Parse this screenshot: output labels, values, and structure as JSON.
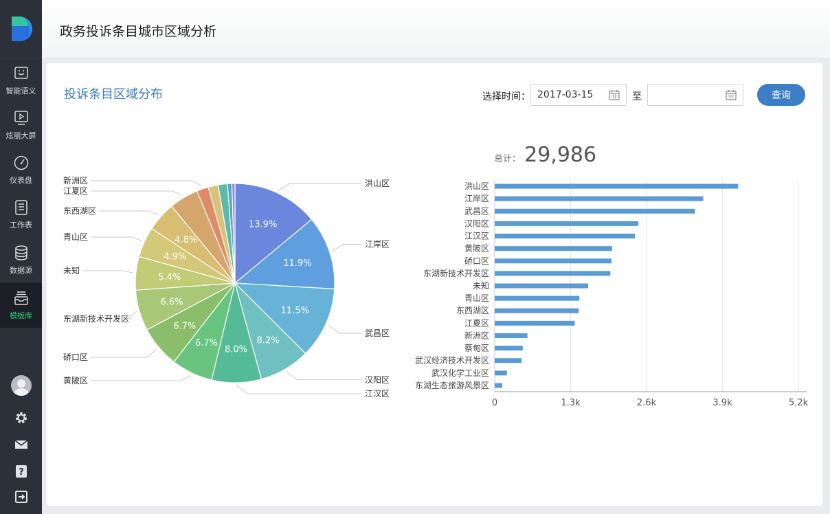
{
  "sidebar": {
    "items": [
      {
        "label": "智能语义",
        "icon": "smile-icon"
      },
      {
        "label": "炫丽大屏",
        "icon": "play-screen-icon"
      },
      {
        "label": "仪表盘",
        "icon": "gauge-icon"
      },
      {
        "label": "工作表",
        "icon": "worksheet-icon"
      },
      {
        "label": "数据源",
        "icon": "database-icon"
      },
      {
        "label": "模板库",
        "icon": "template-icon",
        "active": true
      }
    ],
    "bottom_icons": [
      "avatar",
      "gear-icon",
      "mail-icon",
      "help-icon",
      "logout-icon"
    ]
  },
  "header": {
    "title": "政务投诉条目城市区域分析"
  },
  "panel": {
    "title": "投诉条目区域分布",
    "time_label": "选择时间：",
    "start_date": "2017-03-15",
    "end_date": "",
    "to_label": "至",
    "query_button": "查询"
  },
  "total": {
    "label": "总计：",
    "value": "29,986"
  },
  "colors": {
    "accent": "#3d7fc6",
    "bar": "#5b9bd5",
    "active_nav": "#27d07e"
  },
  "chart_data": [
    {
      "type": "pie",
      "categories": [
        "洪山区",
        "江岸区",
        "武昌区",
        "汉阳区",
        "江汉区",
        "黄陂区",
        "硚口区",
        "东湖新技术开发区",
        "未知",
        "青山区",
        "东西湖区",
        "江夏区",
        "新洲区",
        "蔡甸区",
        "武汉经济技术开发区",
        "武汉化学工业区",
        "东湖生态旅游风景区"
      ],
      "values": [
        13.9,
        11.9,
        11.5,
        8.2,
        8.0,
        6.7,
        6.7,
        6.6,
        5.4,
        4.9,
        4.8,
        4.7,
        1.9,
        1.6,
        1.5,
        0.7,
        0.5
      ],
      "data_labels": [
        "13.9%",
        "11.9%",
        "11.5%",
        "8.2%",
        "8.0%",
        "6.7%",
        "6.7%",
        "6.6%",
        "5.4%",
        "4.9%",
        "4.8%",
        "",
        "",
        "",
        "",
        "",
        ""
      ],
      "outside_labels": [
        "洪山区",
        "江岸区",
        "武昌区",
        "汉阳区",
        "江汉区",
        "黄陂区",
        "硚口区",
        "东湖新技术开发区",
        "未知",
        "青山区",
        "东西湖区",
        "江夏区",
        "新洲区",
        "",
        "",
        "",
        ""
      ],
      "colors": [
        "#6a86dd",
        "#5f9fe0",
        "#66b3d7",
        "#70bfc1",
        "#55ba97",
        "#68c47f",
        "#8bbe6a",
        "#a8c878",
        "#c2cb76",
        "#d3c877",
        "#d8bd73",
        "#d4a66c",
        "#de8c65",
        "#d8c27c",
        "#5dbaaa",
        "#4fa8c8",
        "#9b83d8"
      ]
    },
    {
      "type": "bar",
      "orientation": "horizontal",
      "categories": [
        "洪山区",
        "江岸区",
        "武昌区",
        "汉阳区",
        "江汉区",
        "黄陂区",
        "硚口区",
        "东湖新技术开发区",
        "未知",
        "青山区",
        "东西湖区",
        "江夏区",
        "新洲区",
        "蔡甸区",
        "武汉经济技术开发区",
        "武汉化学工业区",
        "东湖生态旅游风景区"
      ],
      "values": [
        4170,
        3570,
        3430,
        2460,
        2400,
        2010,
        2000,
        1980,
        1600,
        1450,
        1440,
        1370,
        560,
        480,
        460,
        210,
        130
      ],
      "xlim": [
        0,
        5200
      ],
      "ticks": [
        "0",
        "1.3k",
        "2.6k",
        "3.9k",
        "5.2k"
      ],
      "grid": true
    }
  ]
}
